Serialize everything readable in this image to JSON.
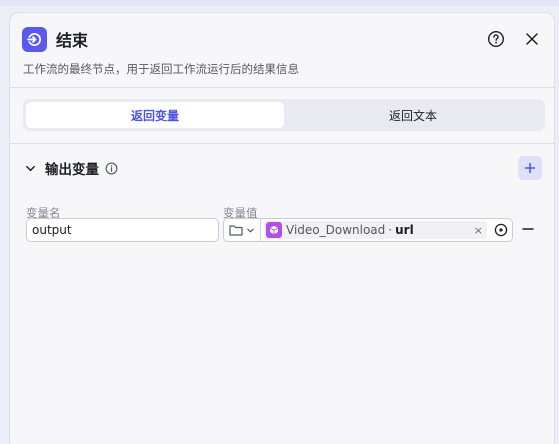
{
  "node": {
    "title": "结束",
    "description": "工作流的最终节点，用于返回工作流运行后的结果信息",
    "icon": "end-node-icon"
  },
  "header_actions": {
    "help_icon": "help-icon",
    "close_icon": "close-icon"
  },
  "tabs": [
    {
      "label": "返回变量",
      "active": true
    },
    {
      "label": "返回文本",
      "active": false
    }
  ],
  "output_section": {
    "title": "输出变量",
    "info_icon": "info-icon",
    "add_icon": "plus-icon",
    "col_name_label": "变量名",
    "col_value_label": "变量值",
    "rows": [
      {
        "name": "output",
        "type_icon": "folder-icon",
        "ref_node": "Video_Download",
        "ref_separator": "·",
        "ref_field": "url",
        "clear_symbol": "×"
      }
    ]
  },
  "colors": {
    "accent": "#4d53e8",
    "node_icon_bg": "#5b58f0",
    "ref_node_icon_bg": "#b14fe8",
    "panel_bg": "#f7f7fa"
  }
}
